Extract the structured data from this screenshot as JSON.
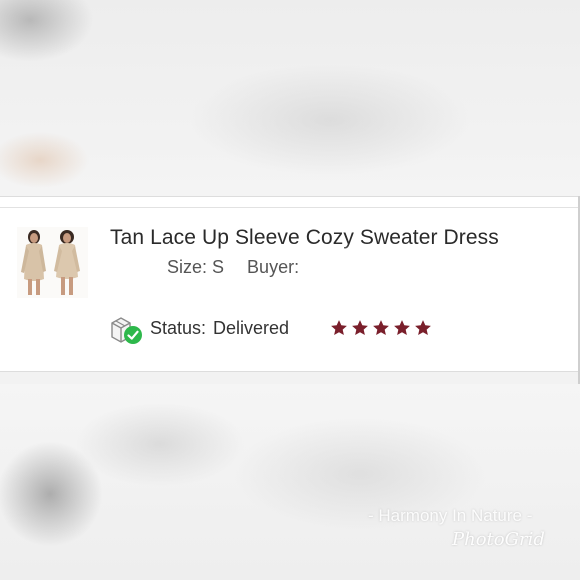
{
  "listing": {
    "title": "Tan Lace Up Sleeve Cozy Sweater Dress",
    "size_label": "Size: S",
    "buyer_label": "Buyer:",
    "status_label": "Status:",
    "status_value": "Delivered",
    "rating_stars": 5,
    "star_color": "#7a1f2b",
    "status_icon": "box-check-icon",
    "status_check_color": "#2eb84b"
  },
  "overlay": {
    "watermark": "- Harmony In Nature -",
    "brand": "PhotoGrid"
  }
}
